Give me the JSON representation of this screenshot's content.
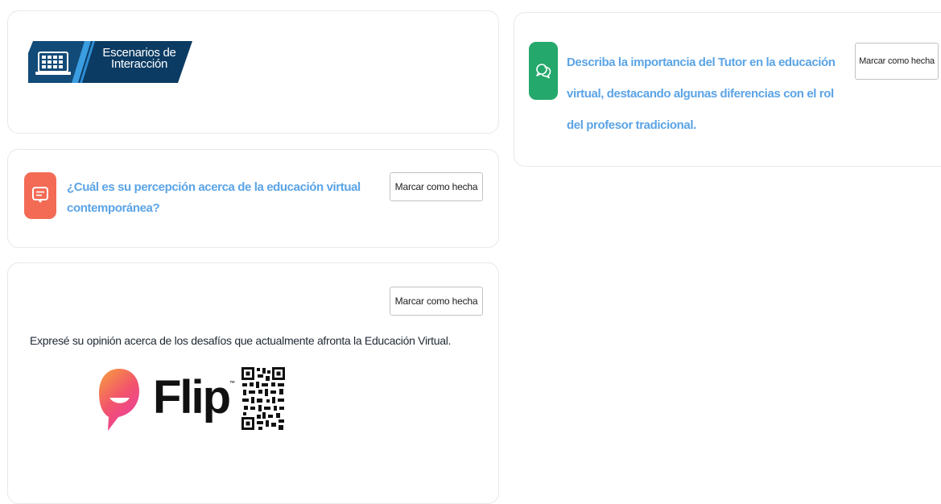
{
  "banner": {
    "title_line1": "Escenarios de",
    "title_line2": "Interacción"
  },
  "activities": [
    {
      "title": "¿Cuál es su percepción acerca de la educación virtual contemporánea?",
      "button": "Marcar como hecha",
      "icon": "forum-icon",
      "icon_color": "#f36b55"
    },
    {
      "instructions": "Expresé su opinión acerca de los desafíos que actualmente afronta la Educación Virtual.",
      "button": "Marcar como hecha",
      "logo_text": "Flip",
      "logo_tm": "™"
    },
    {
      "title": "Describa la importancia del Tutor en la educación virtual, destacando algunas diferencias con el rol del profesor tradicional.",
      "button": "Marcar como hecha",
      "icon": "chat-icon",
      "icon_color": "#24a86b"
    }
  ],
  "colors": {
    "link": "#5ba4e6",
    "banner_dark": "#0b3b63",
    "banner_accent": "#2e8fd6"
  }
}
